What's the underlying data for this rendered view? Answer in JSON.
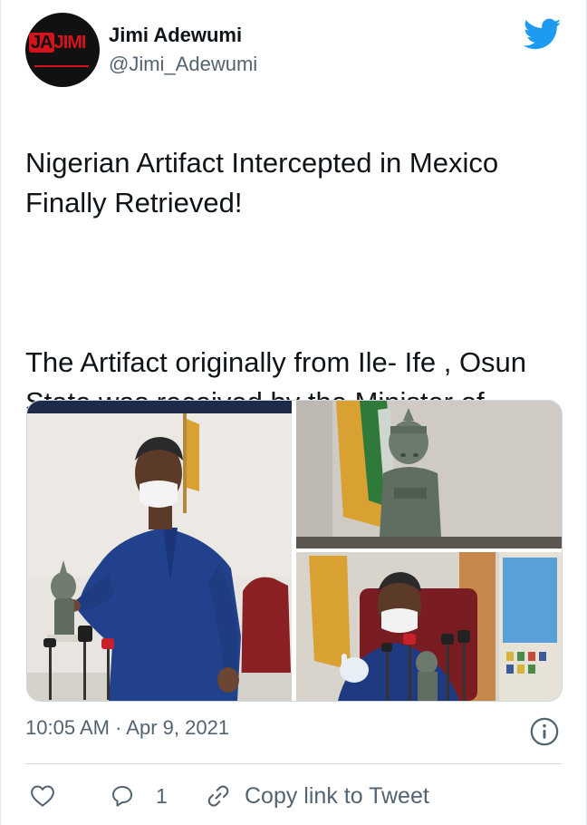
{
  "user": {
    "name": "Jimi Adewumi",
    "handle": "@Jimi_Adewumi",
    "avatar_text": "JIMI"
  },
  "tweet": {
    "text_p1": "Nigerian Artifact Intercepted in Mexico Finally Retrieved!",
    "text_p2": "The Artifact originally from Ile- Ife , Osun State was received by the Minister of Foreign Affairs , Geoffrey Onyeama."
  },
  "meta": {
    "timestamp": "10:05 AM · Apr 9, 2021"
  },
  "actions": {
    "reply_count": "1",
    "copy_link_label": "Copy link to Tweet"
  },
  "icons": {
    "brand": "twitter-bird-icon",
    "info": "info-icon",
    "like": "heart-icon",
    "reply": "reply-bubble-icon",
    "copy": "link-icon"
  },
  "colors": {
    "twitter_blue": "#1d9bf0",
    "text": "#0f1419",
    "muted": "#536471",
    "border": "#cfd9de"
  }
}
